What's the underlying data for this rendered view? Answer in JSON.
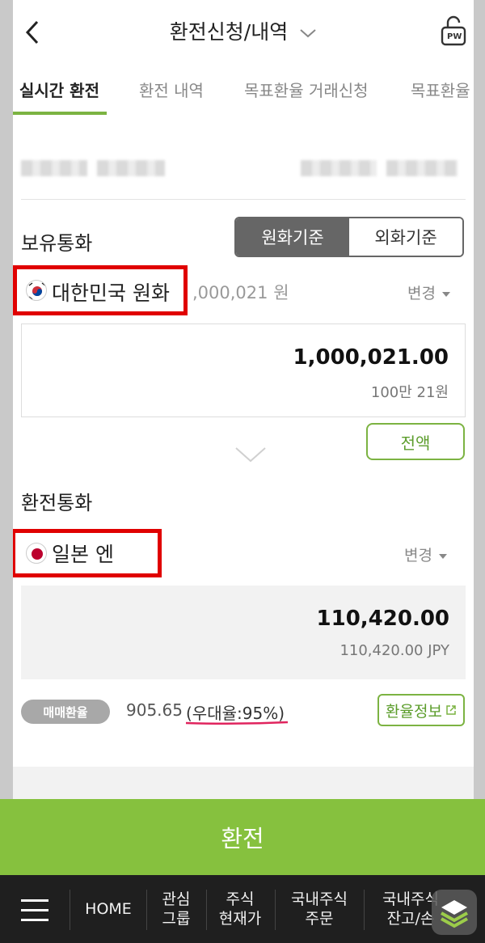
{
  "header": {
    "title": "환전신청/내역",
    "pw_label": "PW"
  },
  "tabs": [
    {
      "label": "실시간 환전",
      "active": true
    },
    {
      "label": "환전 내역",
      "active": false
    },
    {
      "label": "목표환율 거래신청",
      "active": false
    },
    {
      "label": "목표환율 거",
      "active": false
    }
  ],
  "owned": {
    "section_title": "보유통화",
    "toggle": {
      "krw_basis": "원화기준",
      "fx_basis": "외화기준",
      "selected": "원화기준"
    },
    "currency_name": "대한민국 원화",
    "balance": ",000,021 원",
    "change_label": "변경",
    "amount": "1,000,021.00",
    "amount_korean": "100만 21원",
    "all_button": "전액"
  },
  "target": {
    "section_title": "환전통화",
    "currency_name": "일본 엔",
    "change_label": "변경",
    "amount": "110,420.00",
    "amount_sub": "110,420.00 JPY"
  },
  "rate": {
    "label": "매매환율",
    "value": "905.65",
    "preferential": "(우대율:95%)",
    "info_button": "환율정보"
  },
  "exchange_button": "환전",
  "bottom_nav": {
    "home": "HOME",
    "items": [
      {
        "line1": "관심",
        "line2": "그룹"
      },
      {
        "line1": "주식",
        "line2": "현재가"
      },
      {
        "line1": "국내주식",
        "line2": "주문"
      },
      {
        "line1": "국내주식",
        "line2": "잔고/손"
      }
    ]
  },
  "colors": {
    "accent_green": "#86c13e",
    "highlight_red": "#e00000",
    "nav_dark": "#1f1f1f"
  }
}
